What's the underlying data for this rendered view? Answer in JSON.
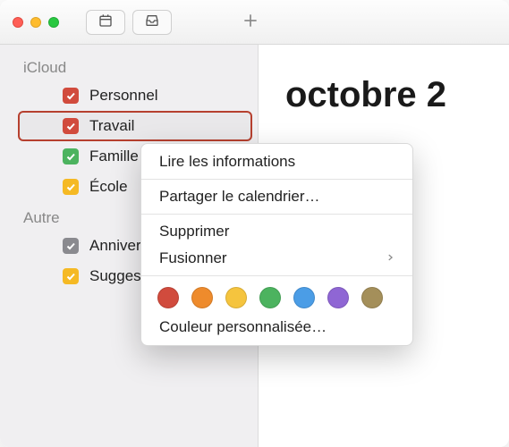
{
  "titlebar": {
    "icons": {
      "calendar": "calendar",
      "inbox": "inbox",
      "plus": "plus"
    }
  },
  "main": {
    "month_label": "octobre 2"
  },
  "sidebar": {
    "groups": [
      {
        "label": "iCloud",
        "items": [
          {
            "label": "Personnel",
            "color": "#d14b3d",
            "selected": false
          },
          {
            "label": "Travail",
            "color": "#d14b3d",
            "selected": true
          },
          {
            "label": "Famille",
            "color": "#4cb35f",
            "selected": false
          },
          {
            "label": "École",
            "color": "#f5b924",
            "selected": false
          }
        ]
      },
      {
        "label": "Autre",
        "items": [
          {
            "label": "Anniver",
            "color": "#8a8a8f",
            "selected": false
          },
          {
            "label": "Sugges",
            "color": "#f5b924",
            "selected": false
          }
        ]
      }
    ]
  },
  "context_menu": {
    "info": "Lire les informations",
    "share": "Partager le calendrier…",
    "delete": "Supprimer",
    "merge": "Fusionner",
    "custom_color": "Couleur personnalisée…",
    "colors": [
      "#d14b3d",
      "#ee8b2c",
      "#f5c43e",
      "#4cb35f",
      "#4b9de6",
      "#8f66d4",
      "#a48f5a"
    ]
  }
}
